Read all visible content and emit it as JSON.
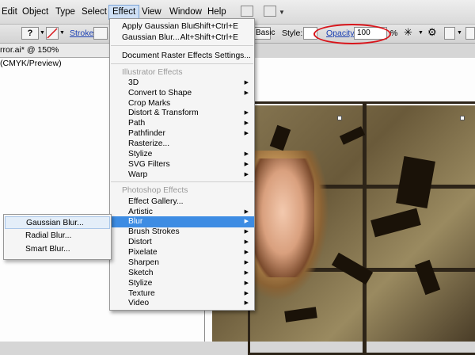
{
  "menubar": {
    "items": [
      {
        "label": "Edit"
      },
      {
        "label": "Object"
      },
      {
        "label": "Type"
      },
      {
        "label": "Select"
      },
      {
        "label": "Effect"
      },
      {
        "label": "View"
      },
      {
        "label": "Window"
      },
      {
        "label": "Help"
      }
    ]
  },
  "controlbar": {
    "stroke_label": "Stroke:",
    "style_preset": "Basic",
    "style_label": "Style:",
    "opacity_label": "Opacity:",
    "opacity_value": "100",
    "percent": "%"
  },
  "document_tab": {
    "title": "rror.ai* @ 150% (CMYK/Preview)"
  },
  "effect_menu": {
    "top": [
      {
        "label": "Apply Gaussian Blur",
        "shortcut": "Shift+Ctrl+E"
      },
      {
        "label": "Gaussian Blur...",
        "shortcut": "Alt+Shift+Ctrl+E"
      },
      {
        "label": "Document Raster Effects Settings..."
      }
    ],
    "illustrator_header": "Illustrator Effects",
    "illustrator_items": [
      {
        "label": "3D",
        "submenu": true
      },
      {
        "label": "Convert to Shape",
        "submenu": true
      },
      {
        "label": "Crop Marks",
        "submenu": false
      },
      {
        "label": "Distort & Transform",
        "submenu": true
      },
      {
        "label": "Path",
        "submenu": true
      },
      {
        "label": "Pathfinder",
        "submenu": true
      },
      {
        "label": "Rasterize...",
        "submenu": false
      },
      {
        "label": "Stylize",
        "submenu": true
      },
      {
        "label": "SVG Filters",
        "submenu": true
      },
      {
        "label": "Warp",
        "submenu": true
      }
    ],
    "photoshop_header": "Photoshop Effects",
    "photoshop_items": [
      {
        "label": "Effect Gallery...",
        "submenu": false
      },
      {
        "label": "Artistic",
        "submenu": true
      },
      {
        "label": "Blur",
        "submenu": true,
        "selected": true
      },
      {
        "label": "Brush Strokes",
        "submenu": true
      },
      {
        "label": "Distort",
        "submenu": true
      },
      {
        "label": "Pixelate",
        "submenu": true
      },
      {
        "label": "Sharpen",
        "submenu": true
      },
      {
        "label": "Sketch",
        "submenu": true
      },
      {
        "label": "Stylize",
        "submenu": true
      },
      {
        "label": "Texture",
        "submenu": true
      },
      {
        "label": "Video",
        "submenu": true
      }
    ]
  },
  "blur_submenu": {
    "items": [
      {
        "label": "Gaussian Blur..."
      },
      {
        "label": "Radial Blur..."
      },
      {
        "label": "Smart Blur..."
      }
    ]
  },
  "colors": {
    "selection": "#3d8ce3",
    "highlight_circle": "#d8141a",
    "link_blue": "#1a3fb3"
  }
}
